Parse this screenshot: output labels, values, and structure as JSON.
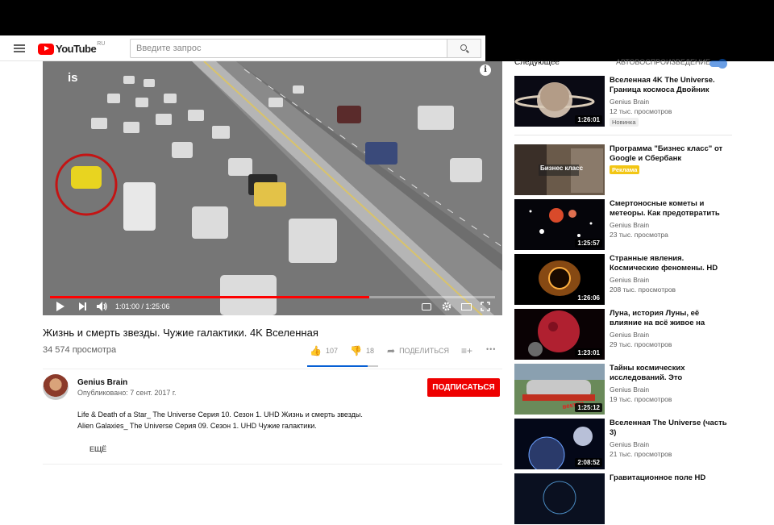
{
  "masthead": {
    "logo_text": "YouTube",
    "logo_region": "RU",
    "search_placeholder": "Введите запрос"
  },
  "player": {
    "overlay_text": "is",
    "info_icon": "i",
    "time_current": "1:01:00",
    "time_total": "1:25:06",
    "time_display": "1:01:00 / 1:25:06",
    "progress_fraction": 0.717
  },
  "video": {
    "title": "Жизнь и смерть звезды. Чужие галактики. 4K Вселенная",
    "views": "34 574 просмотра",
    "likes": "107",
    "dislikes": "18",
    "share_label": "ПОДЕЛИТЬСЯ",
    "more_label": "•••",
    "like_ratio": 0.856
  },
  "channel": {
    "name": "Genius Brain",
    "published": "Опубликовано: 7 сент. 2017 г.",
    "subscribe_label": "ПОДПИСАТЬСЯ"
  },
  "description": {
    "line1": "Life & Death of a Star_ The Universe Серия 10. Сезон 1. UHD Жизнь и смерть звезды.",
    "line2": "Alien Galaxies_ The Universe Серия 09. Сезон 1. UHD Чужие галактики.",
    "more_label": "ЕЩЁ"
  },
  "sidebar": {
    "up_next": "Следующее",
    "autoplay": "АВТОВОСПРОИЗВЕДЕНИЕ",
    "items": [
      {
        "title": "Вселенная 4K The Universe. Граница космоса Двойник",
        "channel": "Genius Brain",
        "views": "12 тыс. просмотров",
        "duration": "1:26:01",
        "badge": "Новинка"
      },
      {
        "title": "Программа \"Бизнес класс\" от Google и Сбербанк",
        "channel": "",
        "views": "",
        "duration": "",
        "badge": "Реклама",
        "thumb_text": "Бизнес класс"
      },
      {
        "title": "Смертоносные кометы и метеоры. Как предотвратить",
        "channel": "Genius Brain",
        "views": "23 тыс. просмотра",
        "duration": "1:25:57",
        "badge": ""
      },
      {
        "title": "Странные явления. Космические феномены. HD",
        "channel": "Genius Brain",
        "views": "208 тыс. просмотров",
        "duration": "1:26:06",
        "badge": ""
      },
      {
        "title": "Луна, история Луны, её влияние на всё живое на",
        "channel": "Genius Brain",
        "views": "29 тыс. просмотров",
        "duration": "1:23:01",
        "badge": ""
      },
      {
        "title": "Тайны космических исследований. Это",
        "channel": "Genius Brain",
        "views": "19 тыс. просмотров",
        "duration": "1:25:12",
        "badge": ""
      },
      {
        "title": "Вселенная The Universe (часть 3)",
        "channel": "Genius Brain",
        "views": "21 тыс. просмотров",
        "duration": "2:08:52",
        "badge": ""
      },
      {
        "title": "Гравитационное поле HD",
        "channel": "Genius Brain",
        "views": "",
        "duration": "",
        "badge": ""
      }
    ]
  },
  "colors": {
    "brand_red": "#ff0000",
    "subscribe_red": "#ee0000",
    "accent_blue": "#065fd4",
    "ad_yellow": "#f2c615"
  }
}
